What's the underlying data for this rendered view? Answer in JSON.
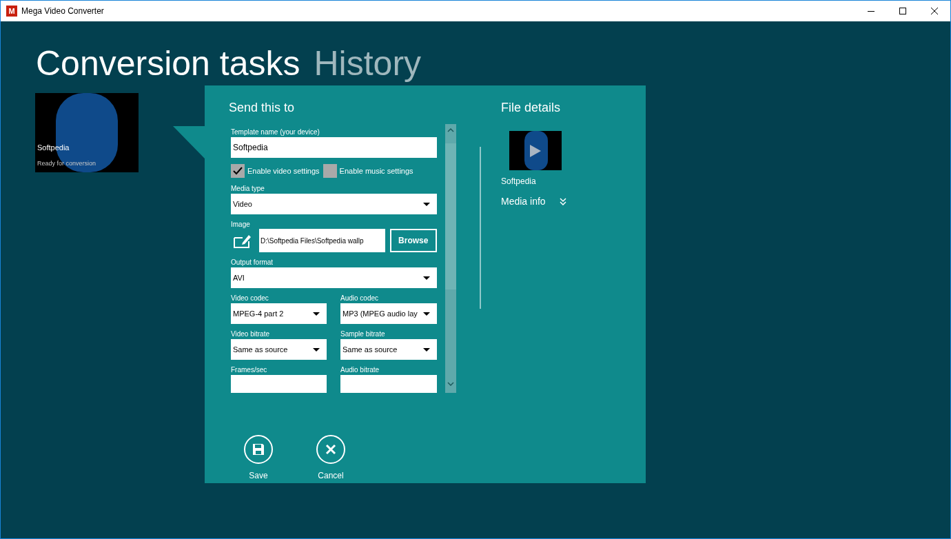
{
  "window": {
    "title": "Mega Video Converter",
    "logo": "M"
  },
  "tabs": [
    {
      "label": "Conversion tasks",
      "selected": true
    },
    {
      "label": "History",
      "selected": false
    }
  ],
  "task_card": {
    "name": "Softpedia",
    "status": "Ready for conversion"
  },
  "send_panel": {
    "title": "Send this to",
    "fields": [
      {
        "kind": "text",
        "label": "Template name (your device)",
        "value": "Softpedia"
      },
      {
        "kind": "checks",
        "items": [
          {
            "label": "Enable video settings",
            "checked": true
          },
          {
            "label": "Enable music settings",
            "checked": false
          }
        ]
      },
      {
        "kind": "select",
        "label": "Media type",
        "value": "Video"
      },
      {
        "kind": "file",
        "label": "Image",
        "value": "D:\\Softpedia Files\\Softpedia wallp",
        "button": "Browse"
      },
      {
        "kind": "select",
        "label": "Output format",
        "value": "AVI"
      },
      {
        "kind": "pair",
        "items": [
          {
            "label": "Video codec",
            "value": "MPEG-4 part 2"
          },
          {
            "label": "Audio codec",
            "value": "MP3 (MPEG audio lay"
          }
        ]
      },
      {
        "kind": "pair",
        "items": [
          {
            "label": "Video bitrate",
            "value": "Same as source"
          },
          {
            "label": "Sample bitrate",
            "value": "Same as source"
          }
        ]
      },
      {
        "kind": "pair",
        "items": [
          {
            "label": "Frames/sec"
          },
          {
            "label": "Audio bitrate"
          }
        ]
      }
    ],
    "actions": [
      {
        "kind": "save",
        "label": "Save"
      },
      {
        "kind": "cancel",
        "label": "Cancel"
      }
    ]
  },
  "file_details": {
    "title": "File details",
    "file_name": "Softpedia",
    "media_info": "Media info"
  }
}
